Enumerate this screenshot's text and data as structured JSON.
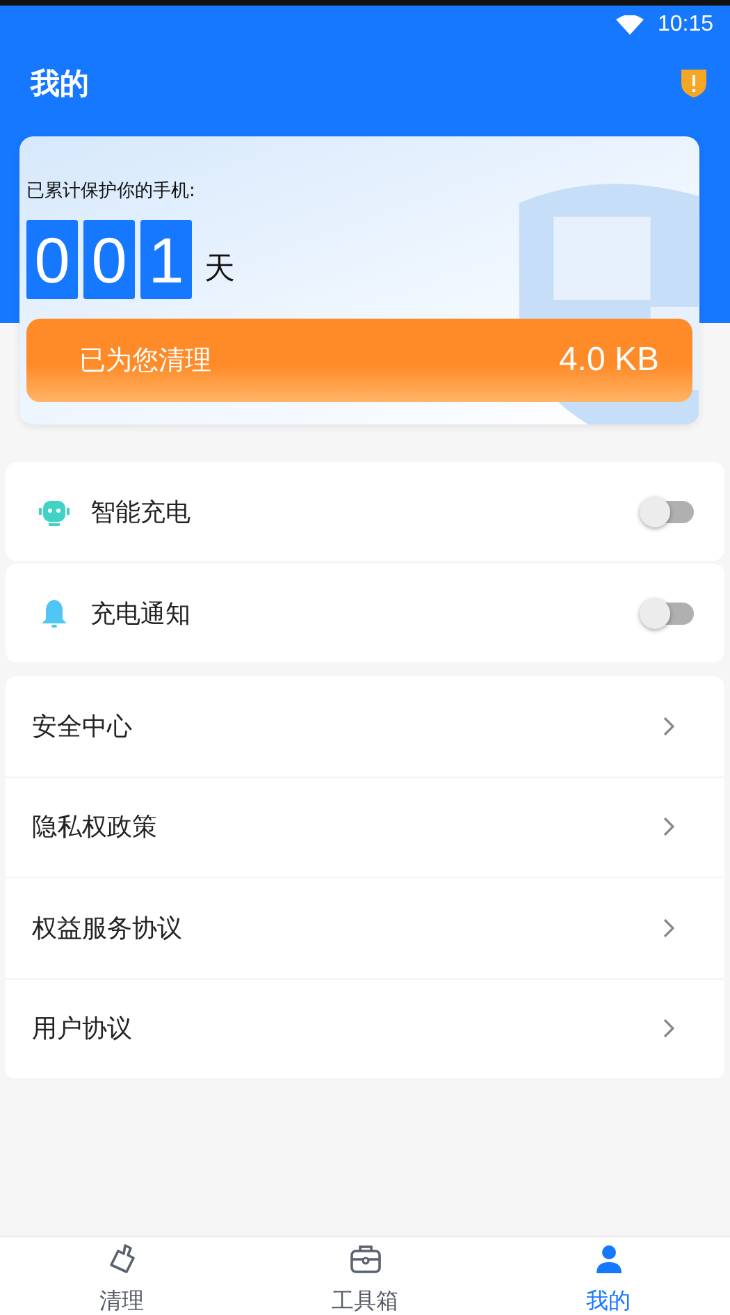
{
  "status_bar": {
    "time": "10:15"
  },
  "header": {
    "title": "我的"
  },
  "protection": {
    "caption": "已累计保护你的手机:",
    "digits": [
      "0",
      "0",
      "1"
    ],
    "unit": "天",
    "cleaned_label": "已为您清理",
    "cleaned_amount": "4.0 KB"
  },
  "toggles": [
    {
      "label": "智能充电",
      "kind": "robot",
      "on": false
    },
    {
      "label": "充电通知",
      "kind": "bell",
      "on": false
    }
  ],
  "menu": [
    "安全中心",
    "隐私权政策",
    "权益服务协议",
    "用户协议"
  ],
  "tabs": [
    {
      "label": "清理",
      "kind": "brush",
      "selected": false
    },
    {
      "label": "工具箱",
      "kind": "toolbox",
      "selected": false
    },
    {
      "label": "我的",
      "kind": "person",
      "selected": true
    }
  ]
}
